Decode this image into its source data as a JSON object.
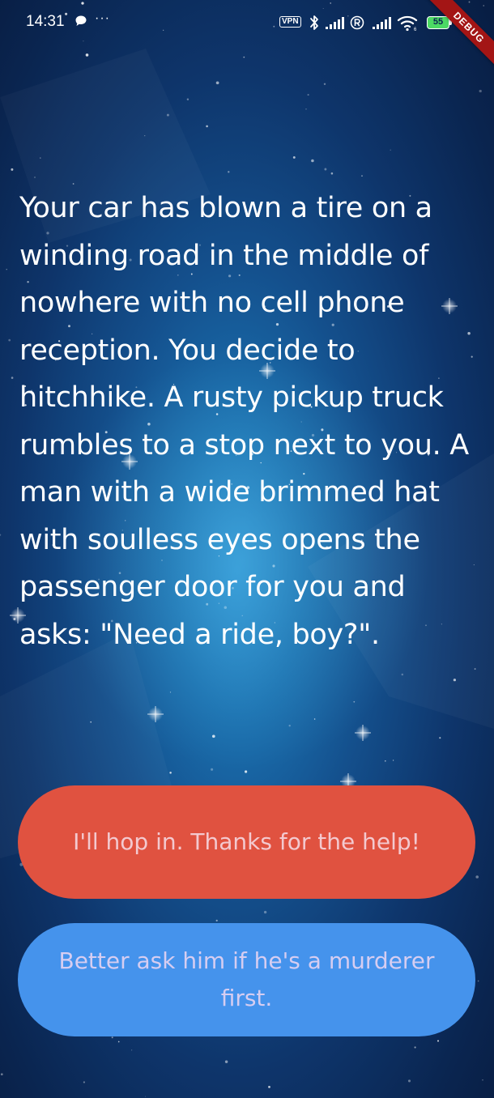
{
  "status_bar": {
    "time": "14:31",
    "dots": "···",
    "vpn": "VPN",
    "battery": "55",
    "debug_banner": "DEBUG"
  },
  "story": {
    "text": "Your car has blown a tire on a winding road in the middle of nowhere with no cell phone reception. You decide to hitchhike. A rusty pickup truck rumbles to a stop next to you. A man with a wide brimmed hat with soulless eyes opens the passenger door for you and asks: \"Need a ride, boy?\"."
  },
  "choices": [
    {
      "label": "I'll hop in. Thanks for the help!",
      "color": "#e05240"
    },
    {
      "label": "Better ask him if he's a murderer first.",
      "color": "#4593ec"
    }
  ],
  "theme": {
    "background_accent": "#1a6fae",
    "background_dark": "#081d42",
    "text": "#ffffff"
  }
}
